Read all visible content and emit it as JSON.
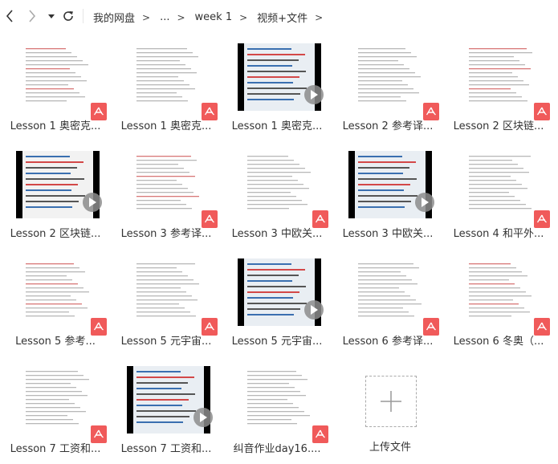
{
  "nav": {
    "back_icon": "chevron-left-icon",
    "forward_icon": "chevron-right-icon",
    "history_icon": "caret-down-icon",
    "refresh_icon": "refresh-icon"
  },
  "breadcrumb": [
    "我的网盘",
    "...",
    "week 1",
    "视频+文件"
  ],
  "breadcrumb_separator": ">",
  "files": [
    {
      "name": "Lesson 1 奥密克...",
      "type": "pdf"
    },
    {
      "name": "Lesson 1 奥密克...",
      "type": "pdf"
    },
    {
      "name": "Lesson 1 奥密克...",
      "type": "video"
    },
    {
      "name": "Lesson 2 参考译...",
      "type": "pdf"
    },
    {
      "name": "Lesson 2 区块链...",
      "type": "pdf"
    },
    {
      "name": "Lesson 2 区块链...",
      "type": "video"
    },
    {
      "name": "Lesson 3 参考译...",
      "type": "pdf"
    },
    {
      "name": "Lesson 3 中欧关...",
      "type": "pdf"
    },
    {
      "name": "Lesson 3 中欧关...",
      "type": "video"
    },
    {
      "name": "Lesson 4 和平外...",
      "type": "pdf"
    },
    {
      "name": "Lesson 5  参考...",
      "type": "pdf"
    },
    {
      "name": "Lesson 5 元宇宙...",
      "type": "pdf"
    },
    {
      "name": "Lesson 5 元宇宙...",
      "type": "video"
    },
    {
      "name": "Lesson 6 参考译...",
      "type": "pdf"
    },
    {
      "name": "Lesson 6 冬奥（...",
      "type": "pdf"
    },
    {
      "name": "Lesson 7 工资和...",
      "type": "pdf"
    },
    {
      "name": "Lesson 7 工资和...",
      "type": "video"
    },
    {
      "name": "纠音作业day16....",
      "type": "pdf"
    }
  ],
  "upload": {
    "label": "上传文件",
    "icon": "plus-icon"
  },
  "colors": {
    "pdf_badge": "#f05a5a",
    "video_bg": "#000000",
    "play_button": "#8c8c8c"
  }
}
